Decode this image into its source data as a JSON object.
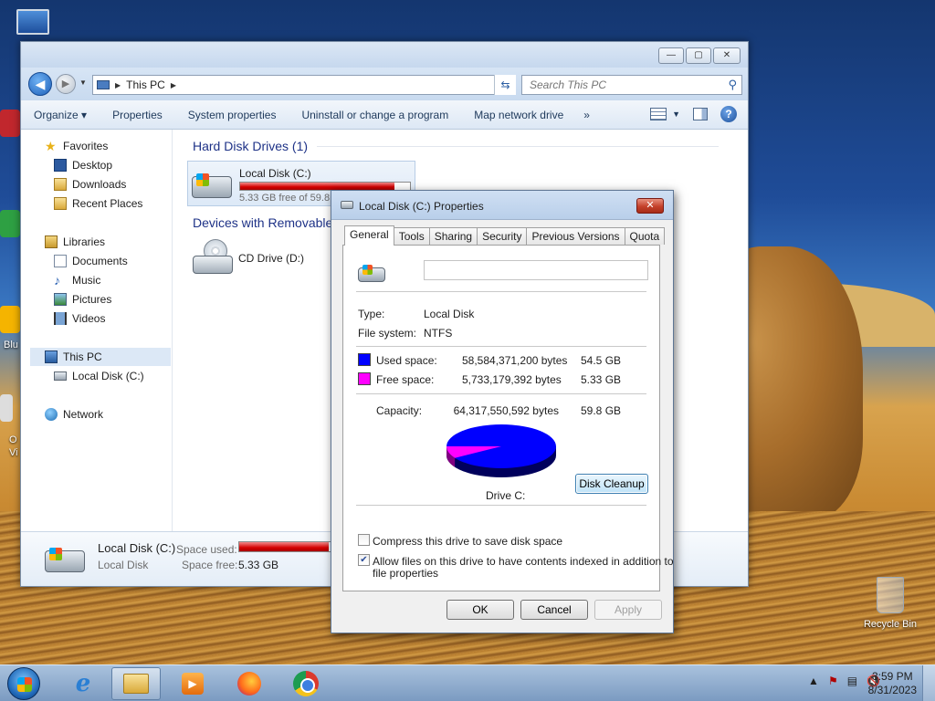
{
  "desktop": {
    "recycle_bin_label": "Recycle Bin",
    "partial_labels": [
      "Blu",
      "O",
      "Vi"
    ]
  },
  "explorer": {
    "address": {
      "location": "This PC"
    },
    "search": {
      "placeholder": "Search This PC"
    },
    "commands": [
      "Organize",
      "Properties",
      "System properties",
      "Uninstall or change a program",
      "Map network drive"
    ],
    "more_label": "»",
    "nav": {
      "favorites": "Favorites",
      "desktop": "Desktop",
      "downloads": "Downloads",
      "recent_places": "Recent Places",
      "libraries": "Libraries",
      "documents": "Documents",
      "music": "Music",
      "pictures": "Pictures",
      "videos": "Videos",
      "this_pc": "This PC",
      "local_disk": "Local Disk (C:)",
      "network": "Network"
    },
    "groups": {
      "hdd_header": "Hard Disk Drives (1)",
      "removable_header": "Devices with Removable"
    },
    "drive_c": {
      "name": "Local Disk (C:)",
      "free_text": "5.33 GB free of 59.8",
      "used_fraction": 0.91
    },
    "drive_d": {
      "name": "CD Drive (D:)"
    },
    "details": {
      "name": "Local Disk (C:)",
      "type": "Local Disk",
      "space_used_label": "Space used:",
      "space_free_label": "Space free:",
      "space_free_value": "5.33 GB",
      "used_fraction": 0.91
    }
  },
  "dialog": {
    "title": "Local Disk (C:) Properties",
    "tabs": [
      "General",
      "Tools",
      "Sharing",
      "Security",
      "Previous Versions",
      "Quota"
    ],
    "name_value": "",
    "type_label": "Type:",
    "type_value": "Local Disk",
    "fs_label": "File system:",
    "fs_value": "NTFS",
    "used_label": "Used space:",
    "used_bytes": "58,584,371,200 bytes",
    "used_gb": "54.5 GB",
    "free_label": "Free space:",
    "free_bytes": "5,733,179,392 bytes",
    "free_gb": "5.33 GB",
    "capacity_label": "Capacity:",
    "capacity_bytes": "64,317,550,592 bytes",
    "capacity_gb": "59.8 GB",
    "drive_label": "Drive C:",
    "cleanup_label": "Disk Cleanup",
    "compress_label": "Compress this drive to save disk space",
    "compress_checked": false,
    "index_label_1": "Allow files on this drive to have contents indexed in addition to",
    "index_label_2": "file properties",
    "index_checked": true,
    "ok_label": "OK",
    "cancel_label": "Cancel",
    "apply_label": "Apply",
    "used_color": "#0000ff",
    "free_color": "#ff00ff",
    "used_fraction": 0.9109
  },
  "taskbar": {
    "time": "3:59 PM",
    "date": "8/31/2023",
    "apps": [
      "windows-explorer",
      "internet-explorer",
      "windows-media-player",
      "firefox",
      "chrome"
    ]
  }
}
